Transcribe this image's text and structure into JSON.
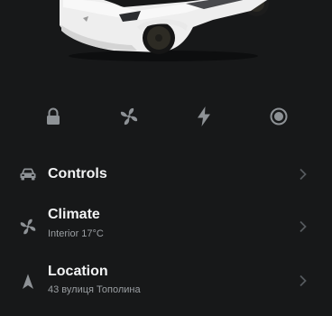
{
  "car": {
    "icon": "car-illustration",
    "body_color": "#f1f1f1"
  },
  "quick_actions": [
    {
      "icon": "lock-icon"
    },
    {
      "icon": "fan-icon"
    },
    {
      "icon": "lightning-icon"
    },
    {
      "icon": "record-icon"
    }
  ],
  "menu": {
    "controls": {
      "label": "Controls",
      "icon": "car-icon"
    },
    "climate": {
      "label": "Climate",
      "sub": "Interior 17°C",
      "icon": "fan-icon"
    },
    "location": {
      "label": "Location",
      "sub": "43 вулиця Тополина",
      "icon": "location-arrow-icon"
    }
  },
  "colors": {
    "background": "#171819",
    "icon": "#8e9296",
    "text": "#f2f3f4",
    "subtext": "#9a9ea2"
  }
}
